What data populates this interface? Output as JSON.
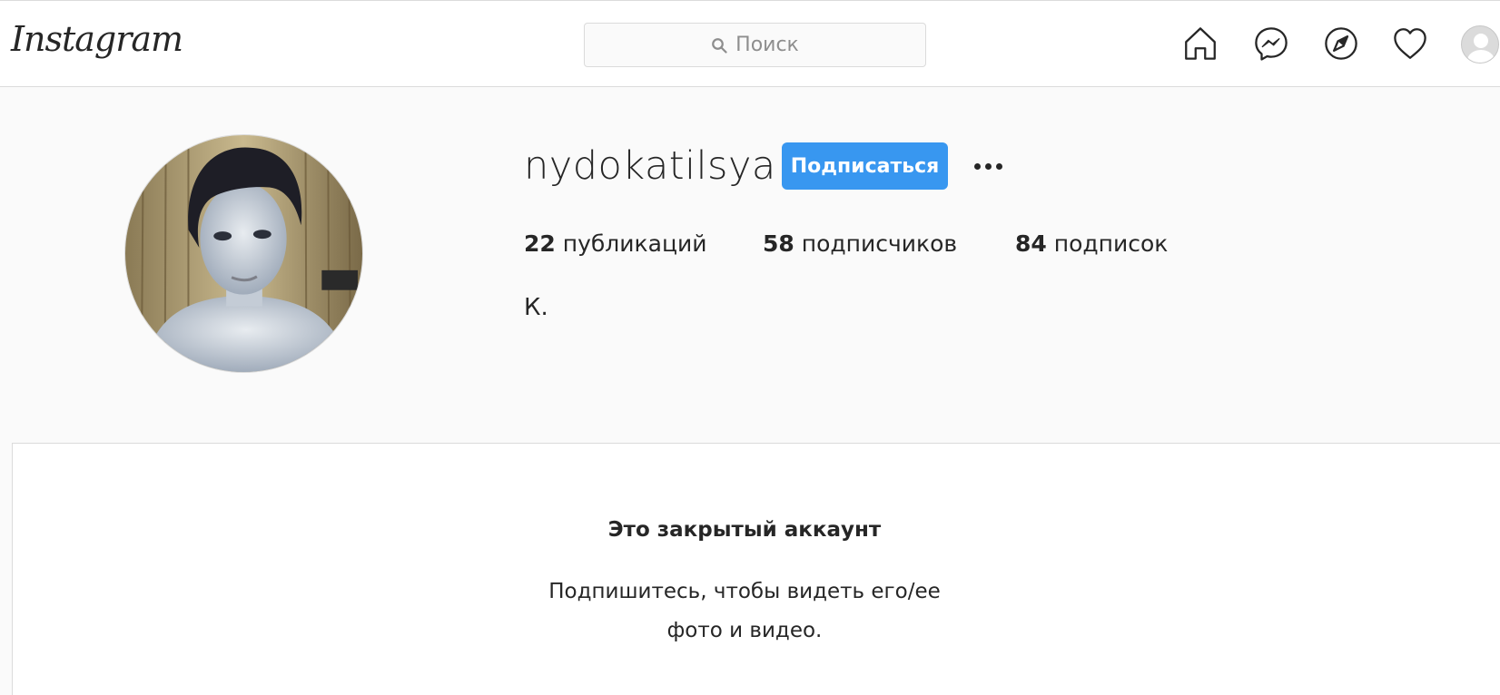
{
  "header": {
    "logo": "Instagram",
    "search_placeholder": "Поиск",
    "icons": [
      "home-icon",
      "messenger-icon",
      "explore-icon",
      "heart-icon",
      "avatar"
    ]
  },
  "profile": {
    "username": "nydokatilsya",
    "follow_label": "Подписаться",
    "stats": {
      "posts_count": "22",
      "posts_label": "публикаций",
      "followers_count": "58",
      "followers_label": "подписчиков",
      "following_count": "84",
      "following_label": "подписок"
    },
    "bio": "К."
  },
  "private_account": {
    "title": "Это закрытый аккаунт",
    "line1": "Подпишитесь, чтобы видеть его/ее",
    "line2": "фото и видео."
  },
  "colors": {
    "accent": "#3897f0",
    "text": "#262626",
    "muted": "#8e8e8e",
    "border": "#dbdbdb",
    "background": "#fafafa"
  }
}
